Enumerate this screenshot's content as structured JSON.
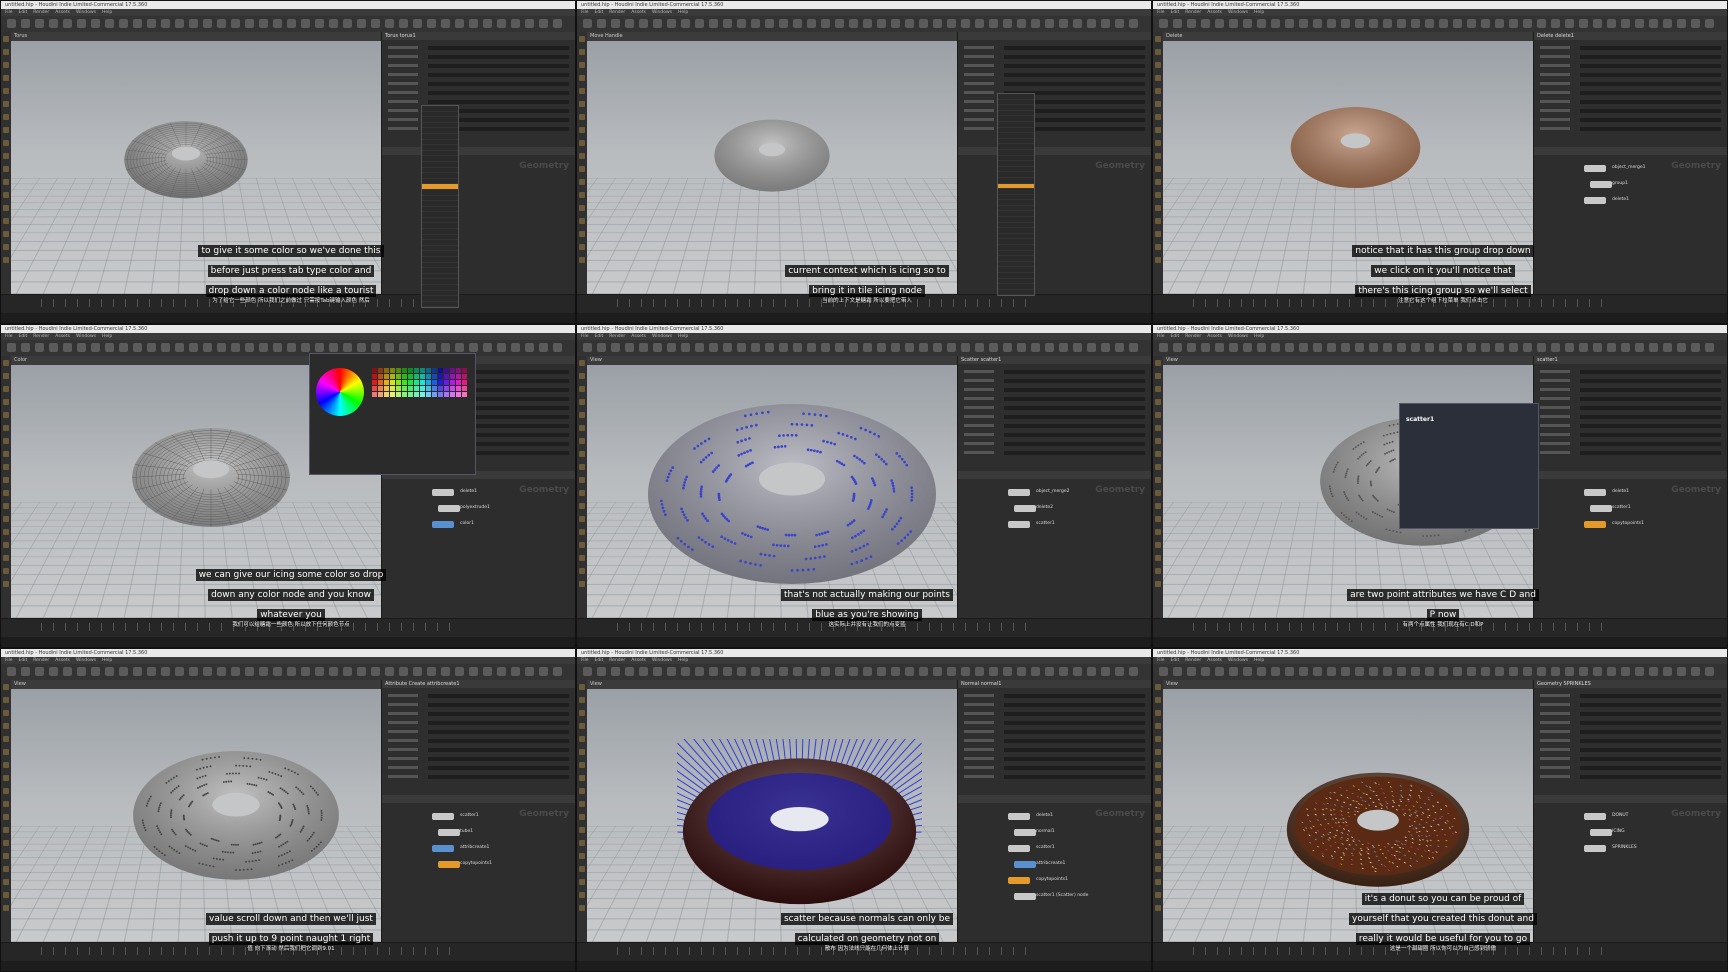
{
  "window_title": "untitled.hip - Houdini Indie Limited-Commercial 17.5.360",
  "menu": [
    "File",
    "Edit",
    "Render",
    "Assets",
    "Windows",
    "Help"
  ],
  "network_watermark": "Geometry",
  "panels": [
    {
      "id": "p1",
      "viewport_label": "Torus",
      "param_title": "Torus torus1",
      "subtitle_lines": [
        "to give it some color so we've done this",
        "before just press tab type color and",
        "drop down a color node like a tourist"
      ],
      "subtitle_cn": "为了给它一些颜色 所以我们之前做过 只需按Tab键输入颜色 然后",
      "nodes": []
    },
    {
      "id": "p2",
      "viewport_label": "Move Handle",
      "param_title": "",
      "subtitle_lines": [
        "current context which is icing so to",
        "bring it in tile icing node"
      ],
      "subtitle_cn": "当前的上下文是糖霜 所以要把它带入",
      "nodes": []
    },
    {
      "id": "p3",
      "viewport_label": "Delete",
      "param_title": "Delete delete1",
      "subtitle_lines": [
        "notice that it has this group drop down",
        "we click on it you'll notice that",
        "there's this icing group so we'll select"
      ],
      "subtitle_cn": "注意它有这个组下拉菜单 我们点击它",
      "nodes": [
        "object_merge1",
        "group1",
        "delete1"
      ]
    },
    {
      "id": "p4",
      "viewport_label": "Color",
      "param_title": "Color Editor",
      "subtitle_lines": [
        "we can give our icing some color so drop",
        "down any color node and you know",
        "whatever you"
      ],
      "subtitle_cn": "我们可以给糖霜一些颜色 所以放下任何颜色节点",
      "nodes": [
        "delete1",
        "polyextrude1",
        "color1"
      ]
    },
    {
      "id": "p5",
      "viewport_label": "View",
      "param_title": "Scatter scatter1",
      "subtitle_lines": [
        "that's not actually making our points",
        "blue as you're showing"
      ],
      "subtitle_cn": "这实际上并没有让我们的点变蓝",
      "nodes": [
        "object_merge2",
        "delete2",
        "scatter1"
      ]
    },
    {
      "id": "p6",
      "viewport_label": "View",
      "param_title": "scatter1",
      "subtitle_lines": [
        "are two point attributes we have C D and",
        "P now"
      ],
      "subtitle_cn": "有两个点属性 我们现在有C D和P",
      "nodes": [
        "delete1",
        "scatter1",
        "copytopoints1"
      ],
      "info_title": "scatter1"
    },
    {
      "id": "p7",
      "viewport_label": "View",
      "param_title": "Attribute Create attribcreate1",
      "subtitle_lines": [
        "value scroll down and then we'll just",
        "push it up to 9 point naught 1 right"
      ],
      "subtitle_cn": "值 向下滚动 然后我们把它调到9.01",
      "nodes": [
        "scatter1",
        "tube1",
        "attribcreate1",
        "copytopoints1"
      ]
    },
    {
      "id": "p8",
      "viewport_label": "View",
      "param_title": "Normal normal1",
      "subtitle_lines": [
        "scatter because normals can only be",
        "calculated on geometry not on"
      ],
      "subtitle_cn": "散布 因为法线只能在几何体上计算",
      "nodes": [
        "delete1",
        "normal1",
        "scatter1",
        "attribcreate1",
        "copytopoints1",
        "scatter1 (Scatter) node"
      ]
    },
    {
      "id": "p9",
      "viewport_label": "View",
      "param_title": "Geometry SPRINKLES",
      "subtitle_lines": [
        "it's a donut so you can be proud of",
        "yourself that you created this donut and",
        "really it would be useful for you to go"
      ],
      "subtitle_cn": "这是一个甜甜圈 所以你可以为自己感到骄傲",
      "nodes": [
        "DONUT",
        "ICING",
        "SPRINKLES"
      ]
    }
  ]
}
